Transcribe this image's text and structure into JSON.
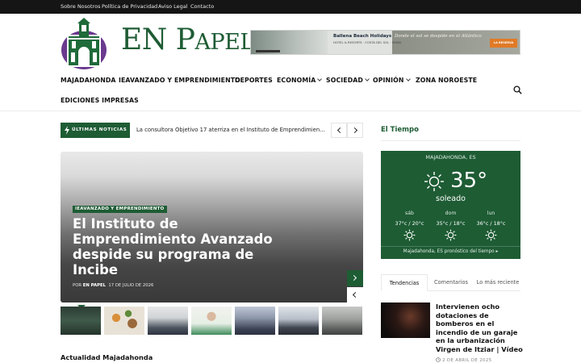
{
  "topbar": {
    "links": [
      "Sobre Nosotros",
      "Política de Privacidad",
      "Aviso Legal",
      "Contacto"
    ]
  },
  "brand": {
    "name_main": "EN P",
    "name_small": "APEL"
  },
  "ad": {
    "title": "Ballena Beach Holidays",
    "subtitle": "HOTEL & RESORTS · COSTA DEL SOL · SPAIN",
    "tagline": "Donde el sol se despide en el Atlántico",
    "cta": "LA RESERVA"
  },
  "nav": {
    "items": [
      {
        "label": "MAJADAHONDA",
        "has_caret": false
      },
      {
        "label": "IEAVANZADO Y EMPRENDIMIENTO",
        "has_caret": false
      },
      {
        "label": "DEPORTES",
        "has_caret": false
      },
      {
        "label": "ECONOMÍA",
        "has_caret": true
      },
      {
        "label": "SOCIEDAD",
        "has_caret": true
      },
      {
        "label": "OPINIÓN",
        "has_caret": true
      },
      {
        "label": "ZONA NOROESTE",
        "has_caret": false
      },
      {
        "label": "EDICIONES IMPRESAS",
        "has_caret": false
      }
    ],
    "search_icon": "search-icon"
  },
  "ticker": {
    "badge": "ÚLTIMAS NOTICIAS",
    "text": "La consultora Objetivo 17 aterriza en el Instituto de Emprendimiento Avanzado"
  },
  "hero": {
    "category": "IEAVANZADO Y EMPRENDIMIENTO",
    "title": "El Instituto de Emprendimiento Avanzado despide su programa de Incibe",
    "by": "POR",
    "author": "EN PAPEL",
    "date": "17 DE JULIO DE 2026"
  },
  "section": {
    "title": "Actualidad Majadahonda"
  },
  "sidebar": {
    "weather_title": "El Tiempo",
    "weather": {
      "location": "MAJADAHONDA, ES",
      "temp": "35°",
      "desc": "soleado",
      "days": [
        {
          "day": "sáb",
          "range": "37°c / 20°c"
        },
        {
          "day": "dom",
          "range": "35°c / 18°c"
        },
        {
          "day": "lun",
          "range": "36°c / 18°c"
        }
      ],
      "footer": "Majadahonda, ES pronóstico del tiempo ▸"
    },
    "tabs": [
      "Tendencias",
      "Comentarios",
      "Lo más reciente"
    ],
    "article": {
      "title": "Intervienen ocho dotaciones de bomberos en el incendio de un garaje en la urbanización Virgen de Itziar | Vídeo",
      "date": "2 DE ABRIL DE 2025"
    }
  },
  "colors": {
    "brand_green": "#1e5c34",
    "topbar": "#151515"
  }
}
